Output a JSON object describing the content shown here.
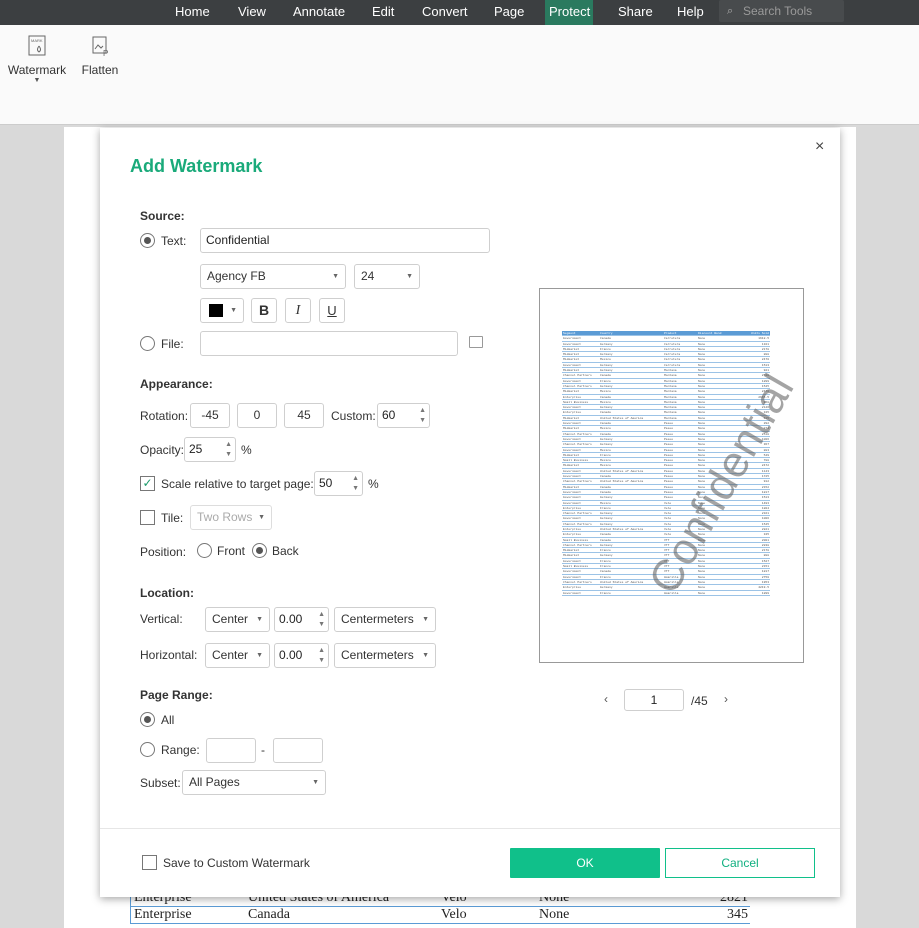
{
  "menubar": {
    "items": [
      "Home",
      "View",
      "Annotate",
      "Edit",
      "Convert",
      "Page",
      "Protect",
      "Share",
      "Help"
    ],
    "active": "Protect",
    "search_placeholder": "Search Tools"
  },
  "ribbon": {
    "watermark": "Watermark",
    "flatten": "Flatten"
  },
  "background_rows": [
    [
      "Enterprise",
      "United States of America",
      "Velo",
      "None",
      "2821"
    ],
    [
      "Enterprise",
      "Canada",
      "Velo",
      "None",
      "345"
    ]
  ],
  "dialog": {
    "title": "Add Watermark",
    "source_label": "Source:",
    "text_label": "Text:",
    "text_value": "Confidential",
    "font": "Agency FB",
    "font_size": "24",
    "font_color": "#000000",
    "bold": "B",
    "italic": "I",
    "underline": "U",
    "file_label": "File:",
    "file_value": "",
    "appearance_label": "Appearance:",
    "rotation_label": "Rotation:",
    "rotation_presets": [
      "-45",
      "0",
      "45"
    ],
    "custom_label": "Custom:",
    "custom_value": "60",
    "opacity_label": "Opacity:",
    "opacity_value": "25",
    "percent": "%",
    "scale_label": "Scale relative to target page:",
    "scale_checked": true,
    "scale_value": "50",
    "tile_label": "Tile:",
    "tile_checked": false,
    "tile_value": "Two Rows",
    "position_label": "Position:",
    "front_label": "Front",
    "back_label": "Back",
    "position_selected": "Back",
    "location_label": "Location:",
    "vertical_label": "Vertical:",
    "vertical_align": "Center",
    "vertical_offset": "0.00",
    "vertical_unit": "Centermeters",
    "horizontal_label": "Horizontal:",
    "horizontal_align": "Center",
    "horizontal_offset": "0.00",
    "horizontal_unit": "Centermeters",
    "page_range_label": "Page Range:",
    "all_label": "All",
    "range_label": "Range:",
    "range_from": "",
    "range_dash": "-",
    "range_to": "",
    "subset_label": "Subset:",
    "subset_value": "All Pages",
    "save_custom_label": "Save to Custom Watermark",
    "ok": "OK",
    "cancel": "Cancel",
    "preview": {
      "current_page": "1",
      "total_pages": "/45",
      "watermark_text": "Confidential",
      "header": [
        "Segment",
        "Country",
        "Product",
        "Discount Band",
        "Units Sold"
      ],
      "header_color": "#5b9bd5",
      "rows": [
        [
          "Government",
          "Canada",
          "Carretera",
          "None",
          "1618.5"
        ],
        [
          "Government",
          "Germany",
          "Carretera",
          "None",
          "1321"
        ],
        [
          "Midmarket",
          "France",
          "Carretera",
          "None",
          "2178"
        ],
        [
          "Midmarket",
          "Germany",
          "Carretera",
          "None",
          "888"
        ],
        [
          "Midmarket",
          "Mexico",
          "Carretera",
          "None",
          "2470"
        ],
        [
          "Government",
          "Germany",
          "Carretera",
          "None",
          "1513"
        ],
        [
          "Midmarket",
          "Germany",
          "Montana",
          "None",
          "921"
        ],
        [
          "Channel Partners",
          "Canada",
          "Montana",
          "None",
          "2518"
        ],
        [
          "Government",
          "France",
          "Montana",
          "None",
          "1899"
        ],
        [
          "Channel Partners",
          "Germany",
          "Montana",
          "None",
          "1545"
        ],
        [
          "Midmarket",
          "Mexico",
          "Montana",
          "None",
          "2470"
        ],
        [
          "Enterprise",
          "Canada",
          "Montana",
          "None",
          "2665.5"
        ],
        [
          "Small Business",
          "Mexico",
          "Montana",
          "None",
          "958"
        ],
        [
          "Government",
          "Germany",
          "Montana",
          "None",
          "2146"
        ],
        [
          "Enterprise",
          "Canada",
          "Montana",
          "None",
          "345"
        ],
        [
          "Midmarket",
          "United States of America",
          "Montana",
          "None",
          "615"
        ],
        [
          "Government",
          "Canada",
          "Paseo",
          "None",
          "292"
        ],
        [
          "Midmarket",
          "Mexico",
          "Paseo",
          "None",
          "974"
        ],
        [
          "Channel Partners",
          "Canada",
          "Paseo",
          "None",
          "2518"
        ],
        [
          "Government",
          "Germany",
          "Paseo",
          "None",
          "1006"
        ],
        [
          "Channel Partners",
          "Germany",
          "Paseo",
          "None",
          "367"
        ],
        [
          "Government",
          "Mexico",
          "Paseo",
          "None",
          "883"
        ],
        [
          "Midmarket",
          "France",
          "Paseo",
          "None",
          "549"
        ],
        [
          "Small Business",
          "Mexico",
          "Paseo",
          "None",
          "788"
        ],
        [
          "Midmarket",
          "Mexico",
          "Paseo",
          "None",
          "2472"
        ],
        [
          "Government",
          "United States of America",
          "Paseo",
          "None",
          "1143"
        ],
        [
          "Government",
          "Canada",
          "Paseo",
          "None",
          "1725"
        ],
        [
          "Channel Partners",
          "United States of America",
          "Paseo",
          "None",
          "912"
        ],
        [
          "Midmarket",
          "Canada",
          "Paseo",
          "None",
          "2152"
        ],
        [
          "Government",
          "Canada",
          "Paseo",
          "None",
          "1817"
        ],
        [
          "Government",
          "Germany",
          "Paseo",
          "None",
          "1513"
        ],
        [
          "Government",
          "Mexico",
          "Velo",
          "None",
          "1493"
        ],
        [
          "Enterprise",
          "France",
          "Velo",
          "None",
          "1804"
        ],
        [
          "Channel Partners",
          "Germany",
          "Velo",
          "None",
          "2161"
        ],
        [
          "Government",
          "Germany",
          "Velo",
          "None",
          "1006"
        ],
        [
          "Channel Partners",
          "Germany",
          "Velo",
          "None",
          "1545"
        ],
        [
          "Enterprise",
          "United States of America",
          "Velo",
          "None",
          "2821"
        ],
        [
          "Enterprise",
          "Canada",
          "Velo",
          "None",
          "345"
        ],
        [
          "Small Business",
          "Canada",
          "VTT",
          "None",
          "2001"
        ],
        [
          "Channel Partners",
          "Germany",
          "VTT",
          "None",
          "2838"
        ],
        [
          "Midmarket",
          "France",
          "VTT",
          "None",
          "2178"
        ],
        [
          "Midmarket",
          "Germany",
          "VTT",
          "None",
          "888"
        ],
        [
          "Government",
          "France",
          "VTT",
          "None",
          "1527"
        ],
        [
          "Small Business",
          "France",
          "VTT",
          "None",
          "2151"
        ],
        [
          "Government",
          "Canada",
          "VTT",
          "None",
          "1817"
        ],
        [
          "Government",
          "France",
          "Amarilla",
          "None",
          "2750"
        ],
        [
          "Channel Partners",
          "United States of America",
          "Amarilla",
          "None",
          "1953"
        ],
        [
          "Enterprise",
          "Germany",
          "Amarilla",
          "None",
          "4219.5"
        ],
        [
          "Government",
          "France",
          "Amarilla",
          "None",
          "1899"
        ]
      ]
    }
  },
  "colors": {
    "accent": "#10c08a",
    "title": "#1aaa7a",
    "menubar": "#3c3f41",
    "active_tab": "#2a7a5f"
  }
}
